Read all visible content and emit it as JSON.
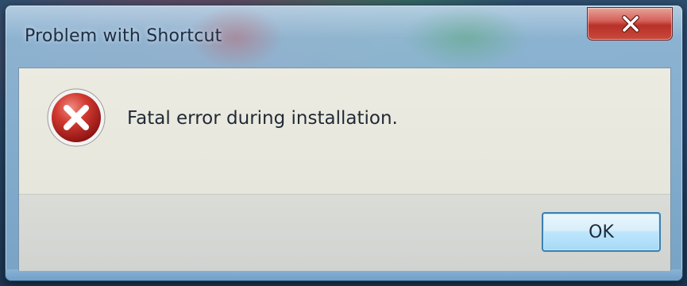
{
  "window": {
    "title": "Problem with Shortcut",
    "close_icon": "close-icon"
  },
  "dialog": {
    "icon": "error-icon",
    "message": "Fatal error during installation.",
    "ok_label": "OK"
  },
  "colors": {
    "close_button_red": "#c9483c",
    "error_icon_red": "#c42b2b",
    "ok_button_border": "#3c7fb1"
  }
}
